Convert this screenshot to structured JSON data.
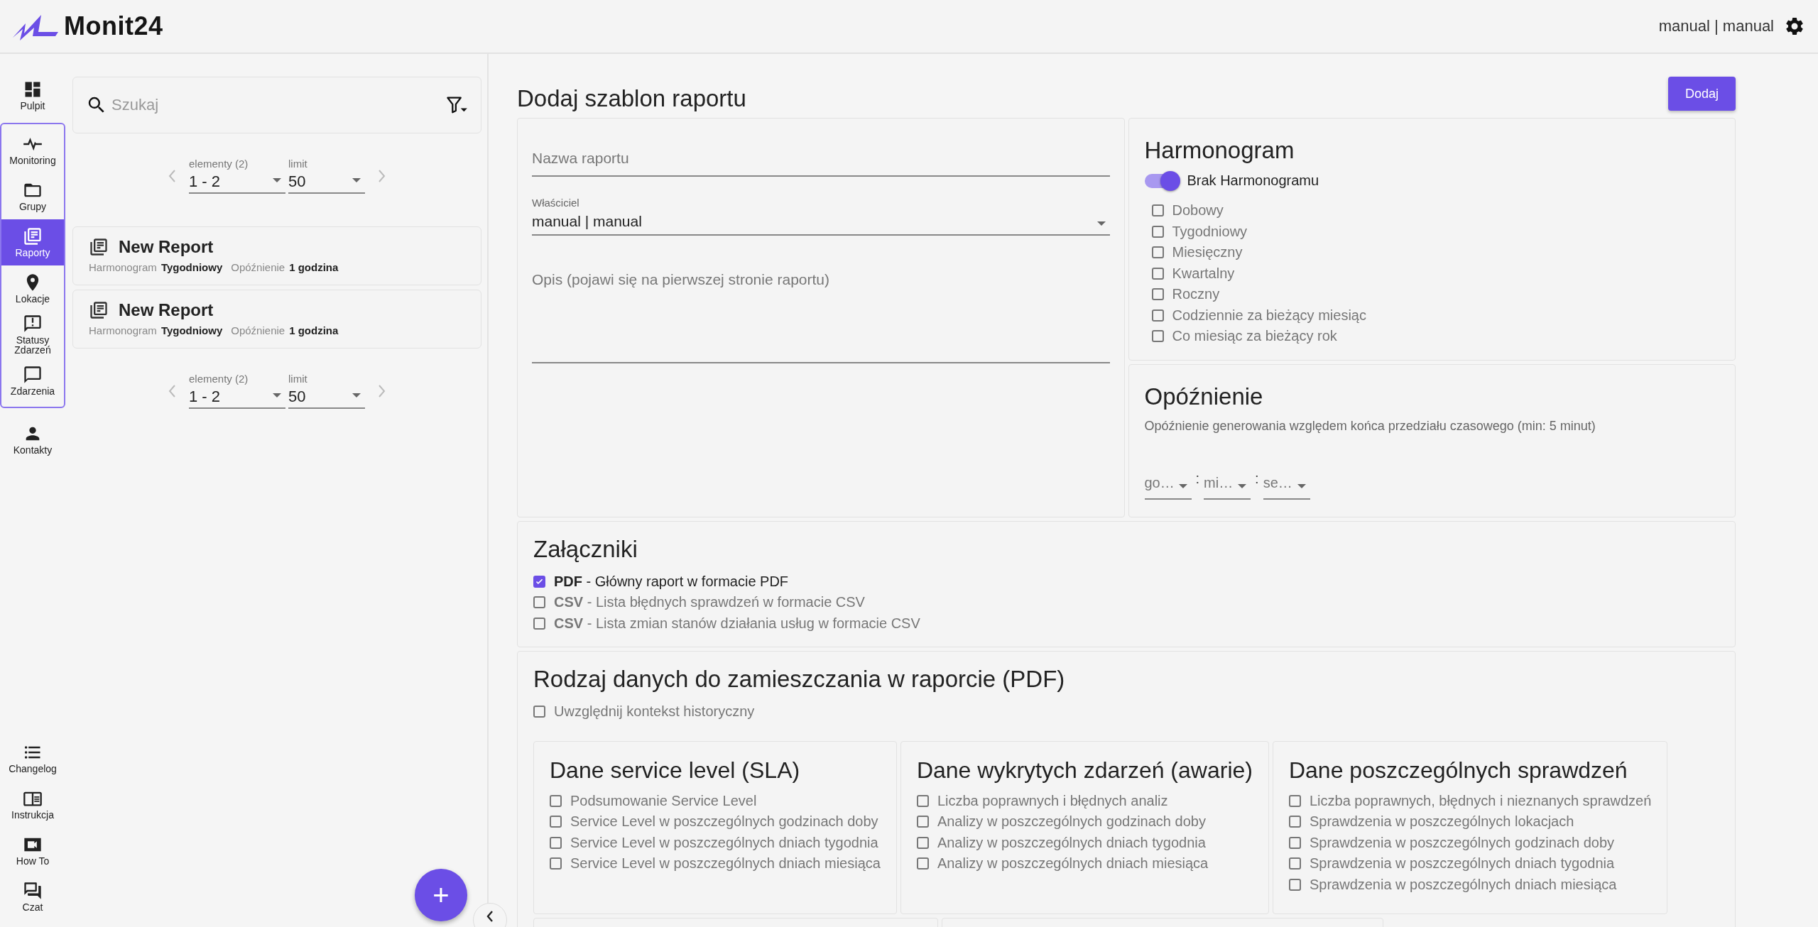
{
  "header": {
    "logo": "Monit24",
    "user": "manual | manual"
  },
  "sidebar": {
    "top": [
      {
        "label": "Pulpit",
        "selected": false
      }
    ],
    "group": [
      {
        "label": "Monitoring",
        "selected": false
      },
      {
        "label": "Grupy",
        "selected": false
      },
      {
        "label": "Raporty",
        "selected": true
      },
      {
        "label": "Lokacje",
        "selected": false
      },
      {
        "label": "Statusy Zdarzeń",
        "selected": false
      },
      {
        "label": "Zdarzenia",
        "selected": false
      }
    ],
    "after": [
      {
        "label": "Kontakty",
        "selected": false
      }
    ],
    "bottom": [
      {
        "label": "Changelog",
        "selected": false
      },
      {
        "label": "Instrukcja",
        "selected": false
      },
      {
        "label": "How To",
        "selected": false
      },
      {
        "label": "Czat",
        "selected": false
      }
    ]
  },
  "list": {
    "search": {
      "placeholder": "Szukaj"
    },
    "pagers": [
      {
        "range_label": "elementy (2)",
        "range": "1 - 2",
        "limit_label": "limit",
        "limit": "50"
      },
      {
        "range_label": "elementy (2)",
        "range": "1 - 2",
        "limit_label": "limit",
        "limit": "50"
      }
    ],
    "reports": [
      {
        "title": "New Report",
        "schedule_label": "Harmonogram",
        "schedule": "Tygodniowy",
        "delay_label": "Opóźnienie",
        "delay": "1 godzina"
      },
      {
        "title": "New Report",
        "schedule_label": "Harmonogram",
        "schedule": "Tygodniowy",
        "delay_label": "Opóźnienie",
        "delay": "1 godzina"
      }
    ],
    "fab": "+"
  },
  "form": {
    "title": "Dodaj szablon raportu",
    "add_button": "Dodaj",
    "name": {
      "placeholder": "Nazwa raportu"
    },
    "owner": {
      "label": "Właściciel",
      "value": "manual | manual"
    },
    "description": {
      "placeholder": "Opis (pojawi się na pierwszej stronie raportu)"
    },
    "schedule": {
      "title": "Harmonogram",
      "toggle": {
        "label": "Brak Harmonogramu",
        "on": true
      },
      "options": [
        {
          "label": "Dobowy",
          "checked": false
        },
        {
          "label": "Tygodniowy",
          "checked": false
        },
        {
          "label": "Miesięczny",
          "checked": false
        },
        {
          "label": "Kwartalny",
          "checked": false
        },
        {
          "label": "Roczny",
          "checked": false
        },
        {
          "label": "Codziennie za bieżący miesiąc",
          "checked": false
        },
        {
          "label": "Co miesiąc za bieżący rok",
          "checked": false
        }
      ]
    },
    "delay": {
      "title": "Opóźnienie",
      "description": "Opóźnienie generowania względem końca przedziału czasowego (min: 5 minut)",
      "fields": [
        {
          "placeholder": "go…"
        },
        {
          "placeholder": "mi…"
        },
        {
          "placeholder": "se…"
        }
      ],
      "separator": ":"
    },
    "attachments": {
      "title": "Załączniki",
      "items": [
        {
          "label": "**PDF** - Główny raport w formacie PDF",
          "checked": true
        },
        {
          "label": "**CSV** - Lista błędnych sprawdzeń w formacie CSV",
          "checked": false
        },
        {
          "label": "**CSV** - Lista zmian stanów działania usług w formacie CSV",
          "checked": false
        }
      ]
    },
    "data_types": {
      "title": "Rodzaj danych do zamieszczania w raporcie (PDF)",
      "historic": {
        "label": "Uwzględnij kontekst historyczny",
        "checked": false
      },
      "groups": [
        {
          "title": "Dane service level (SLA)",
          "options": [
            {
              "label": "Podsumowanie Service Level",
              "checked": false
            },
            {
              "label": "Service Level w poszczególnych godzinach doby",
              "checked": false
            },
            {
              "label": "Service Level w poszczególnych dniach tygodnia",
              "checked": false
            },
            {
              "label": "Service Level w poszczególnych dniach miesiąca",
              "checked": false
            }
          ]
        },
        {
          "title": "Dane wykrytych zdarzeń (awarie)",
          "options": [
            {
              "label": "Liczba poprawnych i błędnych analiz",
              "checked": false
            },
            {
              "label": "Analizy w poszczególnych godzinach doby",
              "checked": false
            },
            {
              "label": "Analizy w poszczególnych dniach tygodnia",
              "checked": false
            },
            {
              "label": "Analizy w poszczególnych dniach miesiąca",
              "checked": false
            }
          ]
        },
        {
          "title": "Dane poszczególnych sprawdzeń",
          "options": [
            {
              "label": "Liczba poprawnych, błędnych i nieznanych sprawdzeń",
              "checked": false
            },
            {
              "label": "Sprawdzenia w poszczególnych lokacjach",
              "checked": false
            },
            {
              "label": "Sprawdzenia w poszczególnych godzinach doby",
              "checked": false
            },
            {
              "label": "Sprawdzenia w poszczególnych dniach tygodnia",
              "checked": false
            },
            {
              "label": "Sprawdzenia w poszczególnych dniach miesiąca",
              "checked": false
            }
          ]
        }
      ]
    }
  }
}
